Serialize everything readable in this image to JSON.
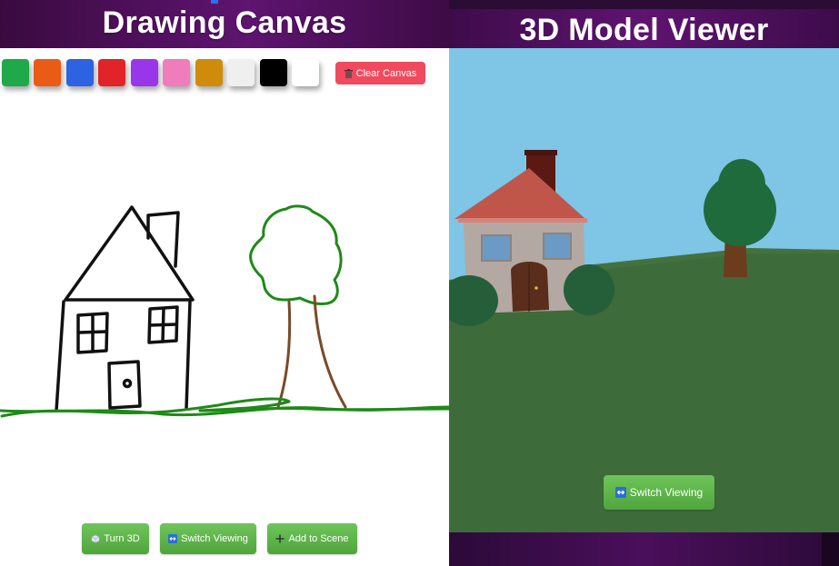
{
  "left_panel": {
    "title": "Drawing Canvas",
    "palette": [
      {
        "name": "green",
        "color": "#1fa94a"
      },
      {
        "name": "orange",
        "color": "#ea5b15"
      },
      {
        "name": "blue",
        "color": "#2d63e2"
      },
      {
        "name": "red",
        "color": "#e02428"
      },
      {
        "name": "purple",
        "color": "#9a36ea"
      },
      {
        "name": "pink",
        "color": "#f17cba"
      },
      {
        "name": "gold",
        "color": "#cf8c0c"
      },
      {
        "name": "light-gray",
        "color": "#efefef"
      },
      {
        "name": "black",
        "color": "#000000"
      },
      {
        "name": "white",
        "color": "#ffffff"
      }
    ],
    "clear_label": "Clear Canvas",
    "buttons": {
      "turn_3d": "Turn 3D",
      "switch_viewing": "Switch Viewing",
      "add_to_scene": "Add to Scene"
    }
  },
  "right_panel": {
    "title": "3D Model Viewer",
    "switch_viewing": "Switch Viewing"
  },
  "colors": {
    "header": "#5e1470",
    "button_green": "#5cb548",
    "danger": "#f04a5f",
    "sky": "#7ec5e6",
    "grass": "#3e6b3a"
  },
  "icons": {
    "clear": "trash-icon",
    "turn_3d": "cube-icon",
    "switch": "swap-icon",
    "add": "plus-icon"
  }
}
